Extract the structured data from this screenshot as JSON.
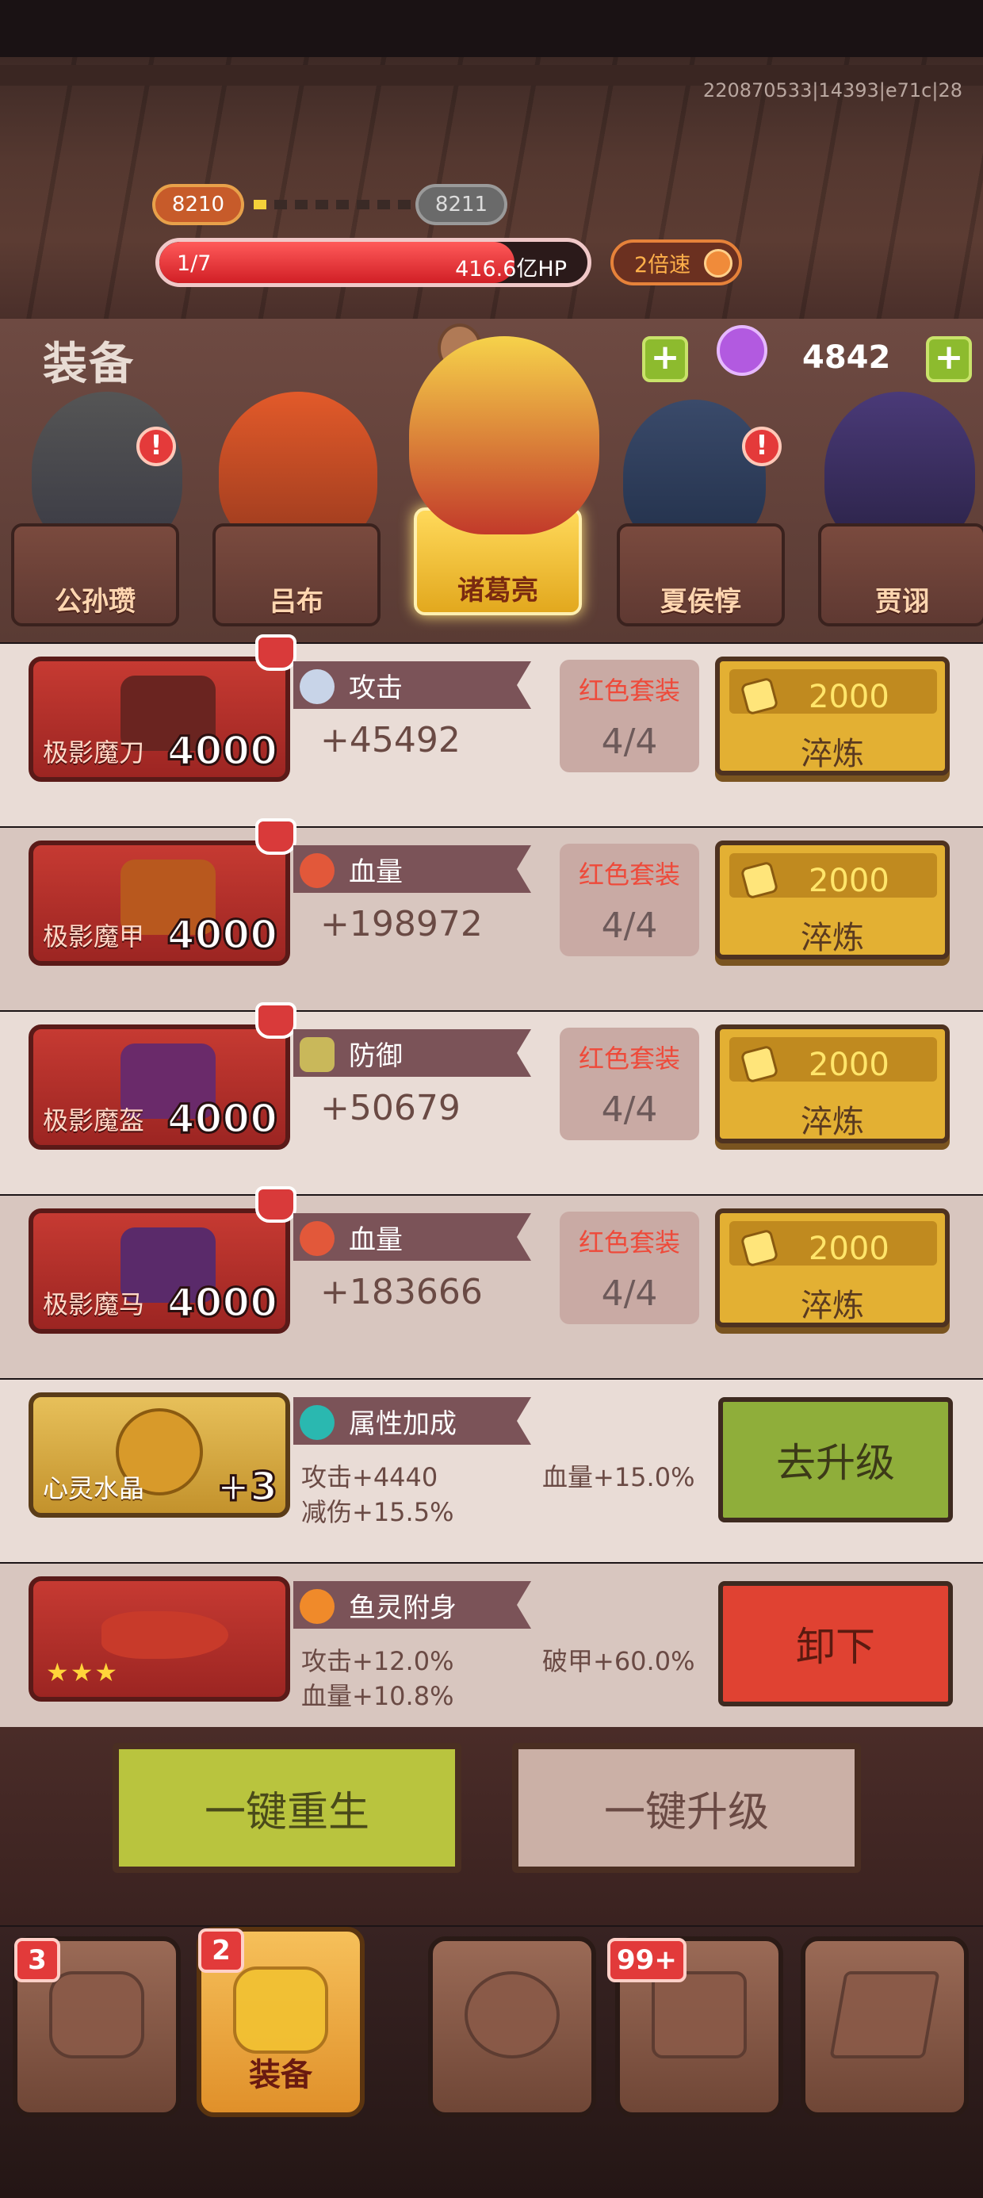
{
  "header": {
    "build_id": "220870533|14393|e71c|28"
  },
  "stage": {
    "current": "8210",
    "next": "8211",
    "progress_dots": 8,
    "progress_lit": 1
  },
  "boss_hp": {
    "wave": "1/7",
    "hp": "416.6亿HP",
    "fill": 0.83
  },
  "speed": {
    "label": "2倍速"
  },
  "panel": {
    "title": "装备",
    "currency_value": "4842"
  },
  "heroes": [
    {
      "name": "公孙瓒",
      "alert": "!",
      "selected": false
    },
    {
      "name": "吕布",
      "alert": "!",
      "selected": false
    },
    {
      "name": "诸葛亮",
      "alert": "",
      "selected": true
    },
    {
      "name": "夏侯惇",
      "alert": "!",
      "selected": false
    },
    {
      "name": "贾诩",
      "alert": "",
      "selected": false
    }
  ],
  "equipment": [
    {
      "name": "极影魔刀",
      "level": "4000",
      "stat_label": "攻击",
      "stat_value": "+45492",
      "set_label": "红色套装",
      "set_count": "4/4",
      "cost": "2000",
      "action": "淬炼",
      "icon": "sword-icon"
    },
    {
      "name": "极影魔甲",
      "level": "4000",
      "stat_label": "血量",
      "stat_value": "+198972",
      "set_label": "红色套装",
      "set_count": "4/4",
      "cost": "2000",
      "action": "淬炼",
      "icon": "blood-drop-icon"
    },
    {
      "name": "极影魔盔",
      "level": "4000",
      "stat_label": "防御",
      "stat_value": "+50679",
      "set_label": "红色套装",
      "set_count": "4/4",
      "cost": "2000",
      "action": "淬炼",
      "icon": "shield-icon"
    },
    {
      "name": "极影魔马",
      "level": "4000",
      "stat_label": "血量",
      "stat_value": "+183666",
      "set_label": "红色套装",
      "set_count": "4/4",
      "cost": "2000",
      "action": "淬炼",
      "icon": "blood-drop-icon"
    }
  ],
  "crystal": {
    "name": "心灵水晶",
    "level": "+3",
    "header": "属性加成",
    "stat1": "攻击+4440",
    "stat2": "血量+15.0%",
    "stat3": "减伤+15.5%",
    "action": "去升级"
  },
  "fish_spirit": {
    "header": "鱼灵附身",
    "stars": "★★★",
    "stat1": "攻击+12.0%",
    "stat2": "破甲+60.0%",
    "stat3": "血量+10.8%",
    "action": "卸下"
  },
  "actions": {
    "rebirth": "一键重生",
    "upgrade": "一键升级"
  },
  "nav": [
    {
      "label": "",
      "badge": "3",
      "icon": "hero-icon"
    },
    {
      "label": "装备",
      "badge": "2",
      "icon": "armor-icon",
      "active": true
    },
    {
      "label": "",
      "badge": "",
      "icon": "skull-icon"
    },
    {
      "label": "",
      "badge": "99+",
      "icon": "chest-icon"
    },
    {
      "label": "",
      "badge": "",
      "icon": "scroll-icon"
    }
  ],
  "colors": {
    "accent_red": "#d11f26",
    "gold": "#e3b033",
    "green_button": "#8fae3a",
    "set_red_text": "#ee4a3a"
  }
}
